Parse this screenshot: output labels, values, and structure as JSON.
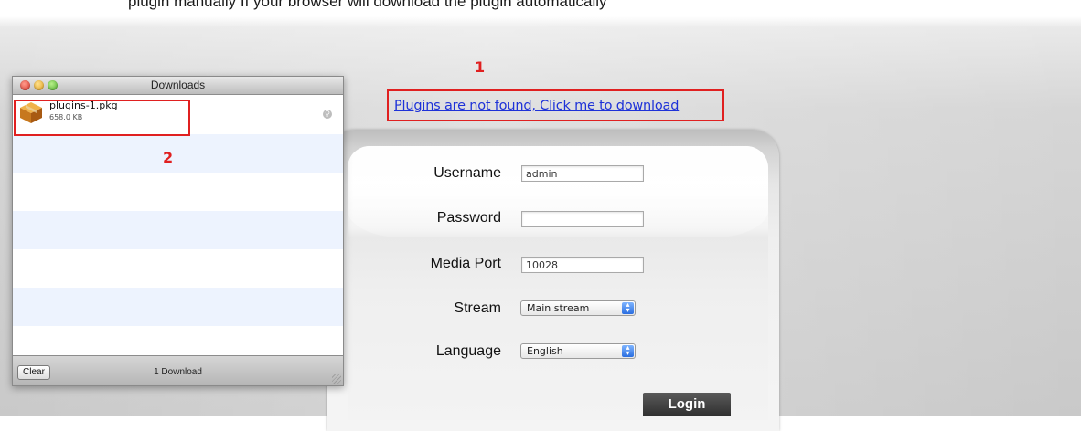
{
  "header": {
    "partial_text": "plugin manually If your browser will download the plugin automatically"
  },
  "annotations": {
    "label_1": "1",
    "label_2": "2"
  },
  "plugin": {
    "link_text": "Plugins are not found, Click me to download"
  },
  "login_form": {
    "username_label": "Username",
    "username_value": "admin",
    "password_label": "Password",
    "password_value": "",
    "media_port_label": "Media Port",
    "media_port_value": "10028",
    "stream_label": "Stream",
    "stream_value": "Main stream",
    "language_label": "Language",
    "language_value": "English",
    "login_button": "Login"
  },
  "downloads_window": {
    "title": "Downloads",
    "items": [
      {
        "filename": "plugins-1.pkg",
        "size": "658.0 KB"
      }
    ],
    "clear_button": "Clear",
    "count_text": "1 Download"
  },
  "colors": {
    "annotation_red": "#e02020",
    "link_blue": "#1e32d8",
    "row_stripe": "#edf3fe",
    "login_button_bg": "#3a3a3a"
  },
  "icons": [
    "close-icon",
    "minimize-icon",
    "zoom-icon",
    "package-icon",
    "magnifier-icon",
    "chevron-updown-icon",
    "resize-grip-icon"
  ]
}
